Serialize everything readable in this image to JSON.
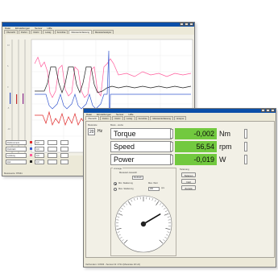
{
  "back_window": {
    "tabs": [
      "Übersicht",
      "Drehm.",
      "Drehz.",
      "Leistg.",
      "Kennlinie",
      "Messwerterfassung",
      "Messwertanalyse"
    ],
    "active_tab": 5,
    "left_values": [
      "Drehmoment",
      "Drehzahl",
      "Leistung",
      "Zeit"
    ],
    "legend_entries": [
      "0,0",
      "0,0",
      "0,0",
      "0,0"
    ],
    "buttons": [
      "Messwerterfassung",
      "Messwertanalyse"
    ],
    "status": "Messwerte: 87941"
  },
  "front_window": {
    "menu": [
      "Datei",
      "Einstellungen",
      "Sensor",
      "Hilfe"
    ],
    "tabs": [
      "Übersicht",
      "Drehm.",
      "Drehz.",
      "Leistg.",
      "Kennlinie",
      "Messwerterfassung",
      "Analyse"
    ],
    "active_tab": 0,
    "rate_label": "Messrate",
    "rate_value": "20",
    "rate_unit": "Hz",
    "meas_label": "Mess - werte",
    "rows": [
      {
        "label": "Torque",
        "value": "-0,002",
        "unit": "Nm"
      },
      {
        "label": "Speed",
        "value": "56,54",
        "unit": "rpm"
      },
      {
        "label": "Power",
        "value": "-0,019",
        "unit": "W"
      }
    ],
    "gauge_group": "Anzeige",
    "gauge_select_label": "Messwert-Auswahl",
    "gauge_select_value": "Drehzahl",
    "radio_1": "Min. Skalierung",
    "radio_2": "Max. Skalierung",
    "max_label": "Max. Wert",
    "max_value": "200",
    "tare_group": "Tarierung",
    "tare_buttons": [
      "Tarieren",
      "Null",
      "Zurück"
    ],
    "status": "Verbunden: COM3 - Sensor-Nr. 4711 (Messrate 20 Hz)"
  },
  "gauge": {
    "value_fraction": 0.72
  },
  "colors": {
    "value_bg": "#72c93f",
    "title": "#0b4fa8"
  }
}
